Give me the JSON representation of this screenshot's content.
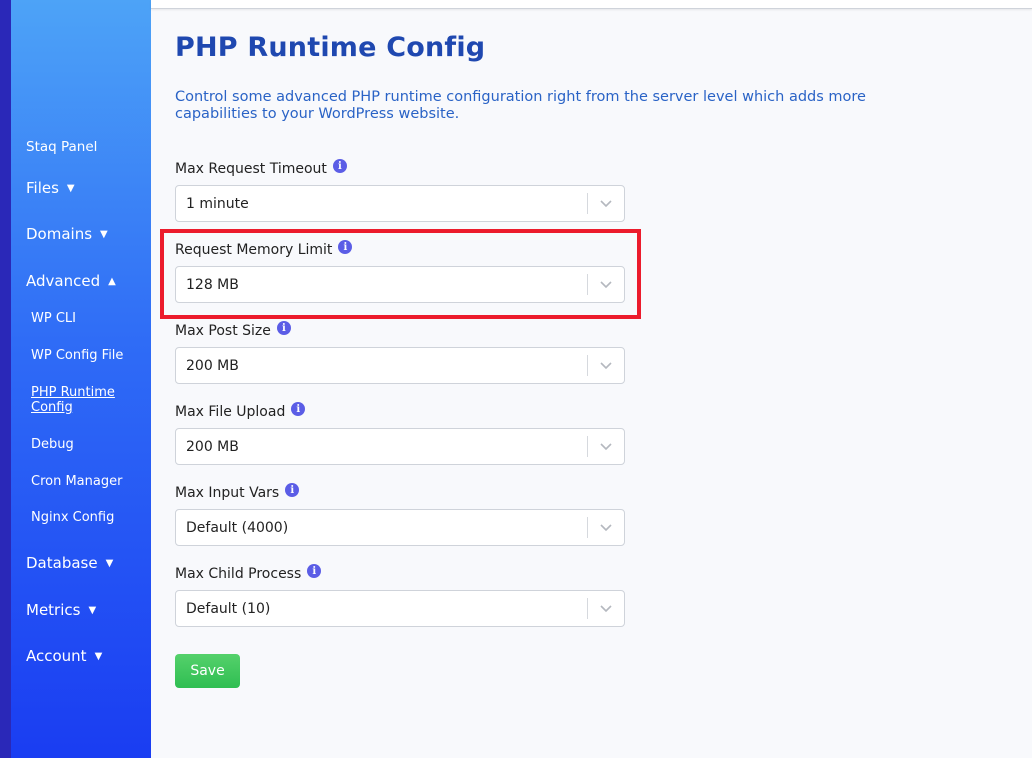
{
  "sidebar": {
    "top_item": "Staq Panel",
    "files": "Files",
    "domains": "Domains",
    "advanced": "Advanced",
    "advanced_items": [
      "WP CLI",
      "WP Config File",
      "PHP Runtime Config",
      "Debug",
      "Cron Manager",
      "Nginx Config"
    ],
    "database": "Database",
    "metrics": "Metrics",
    "account": "Account",
    "collapsed_caret": "▼",
    "expanded_caret": "▲"
  },
  "main": {
    "title": "PHP Runtime Config",
    "description": "Control some advanced PHP runtime configuration right from the server level which adds more capabilities to your WordPress website.",
    "fields": [
      {
        "label": "Max Request Timeout",
        "value": "1 minute"
      },
      {
        "label": "Request Memory Limit",
        "value": "128 MB"
      },
      {
        "label": "Max Post Size",
        "value": "200 MB"
      },
      {
        "label": "Max File Upload",
        "value": "200 MB"
      },
      {
        "label": "Max Input Vars",
        "value": "Default (4000)"
      },
      {
        "label": "Max Child Process",
        "value": "Default (10)"
      }
    ],
    "info_glyph": "i",
    "save_label": "Save"
  },
  "colors": {
    "title": "#1f48b0",
    "description": "#2a63c6",
    "highlight": "#ec1b2c",
    "save": "#34c155",
    "info": "#5b5de6",
    "sidebar_top": "#4da3f7",
    "sidebar_bottom": "#1a3df2"
  }
}
